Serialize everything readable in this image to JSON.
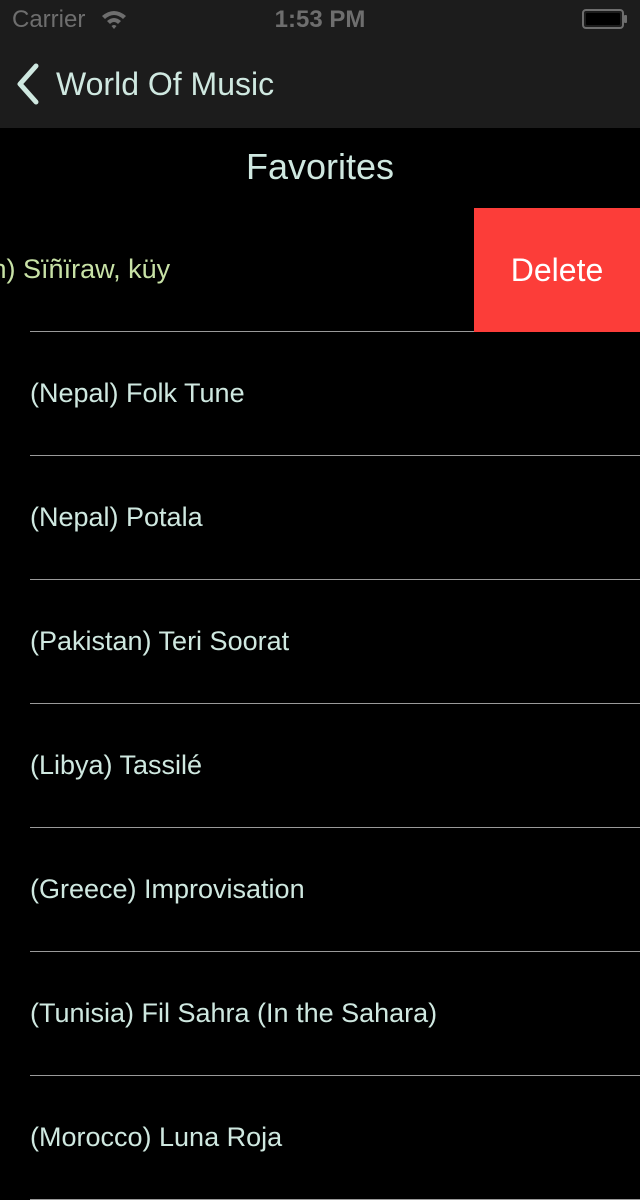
{
  "status_bar": {
    "carrier": "Carrier",
    "time": "1:53 PM",
    "wifi_icon": "wifi-icon",
    "battery_icon": "battery-icon"
  },
  "nav": {
    "back_label": "World Of Music",
    "back_icon": "chevron-left-icon"
  },
  "section": {
    "title": "Favorites"
  },
  "list": {
    "swiped_item": {
      "label": "(Uzbekistan) Sïñïraw, küy",
      "delete_label": "Delete"
    },
    "items": [
      "(Nepal) Folk Tune",
      "(Nepal) Potala",
      "(Pakistan) Teri Soorat",
      "(Libya) Tassilé",
      "(Greece) Improvisation",
      "(Tunisia) Fil Sahra (In the Sahara)",
      "(Morocco) Luna Roja"
    ]
  },
  "colors": {
    "background": "#000000",
    "bar_background": "#1c1c1c",
    "text": "#cfe8e0",
    "swiped_text": "#c8e2a6",
    "delete": "#fc3d39",
    "separator": "#9a9a9a"
  }
}
